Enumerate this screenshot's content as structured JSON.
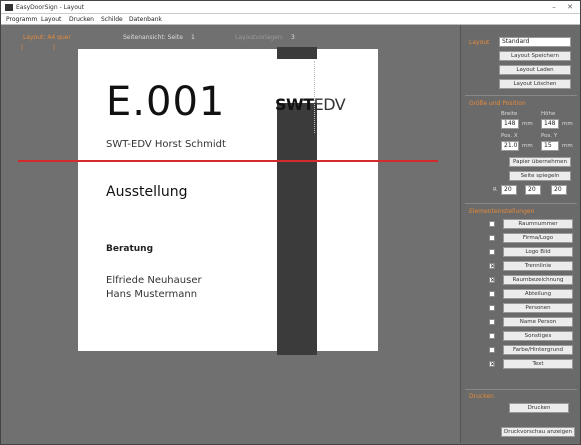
{
  "window": {
    "title": "EasyDoorSign - Layout",
    "minimize": "–",
    "close": "✕"
  },
  "menu": {
    "items": [
      "Programm",
      "Layout",
      "Drucken",
      "Schilde",
      "Datenbank"
    ]
  },
  "toolbar": {
    "layout_label": "Layout: A4 quer",
    "corner_markers": "|",
    "zoom_label": "Seitenansicht: Seite",
    "zoom_value": "1",
    "page_label": "Layoutvorlagen:",
    "page_value": "3"
  },
  "sign": {
    "code": "E.001",
    "company": "SWT-EDV Horst Schmidt",
    "logo_bold": "SWT",
    "logo_thin": "EDV",
    "heading": "Ausstellung",
    "section": "Beratung",
    "names": [
      "Elfriede Neuhauser",
      "Hans Mustermann"
    ]
  },
  "panel": {
    "layout_label": "Layout",
    "layout_value": "Standard",
    "save_label": "Layout Speichern",
    "load_label": "Layout Laden",
    "delete_label": "Layout Löschen",
    "format_label": "Größe und Position",
    "width_label": "Breite",
    "height_label": "Höhe",
    "width_value": "148",
    "height_value": "148",
    "unit": "mm",
    "pos_x_label": "Pos. X",
    "pos_y_label": "Pos. Y",
    "pos_x_value": "21.0",
    "pos_y_value": "15",
    "apply_label": "Papier übernehmen",
    "rotate_label": "Seite spiegeln",
    "margins_label": "R",
    "margin_values": [
      "20",
      "20",
      "20"
    ],
    "elements_label": "Elementeinstellungen",
    "elements": [
      {
        "label": "Raumnummer",
        "checked": false
      },
      {
        "label": "Firma/Logo",
        "checked": false
      },
      {
        "label": "Logo Bild",
        "checked": false
      },
      {
        "label": "Trennlinie",
        "checked": true
      },
      {
        "label": "Raumbezeichnung",
        "checked": true
      },
      {
        "label": "Abteilung",
        "checked": false
      },
      {
        "label": "Personen",
        "checked": false
      },
      {
        "label": "Name Person",
        "checked": false
      },
      {
        "label": "Sonstiges",
        "checked": false
      },
      {
        "label": "Farbe/Hintergrund",
        "checked": false
      },
      {
        "label": "Text",
        "checked": true
      }
    ],
    "print_label": "Drucken",
    "print_button": "Drucken",
    "preview_button": "Druckvorschau anzeigen"
  }
}
